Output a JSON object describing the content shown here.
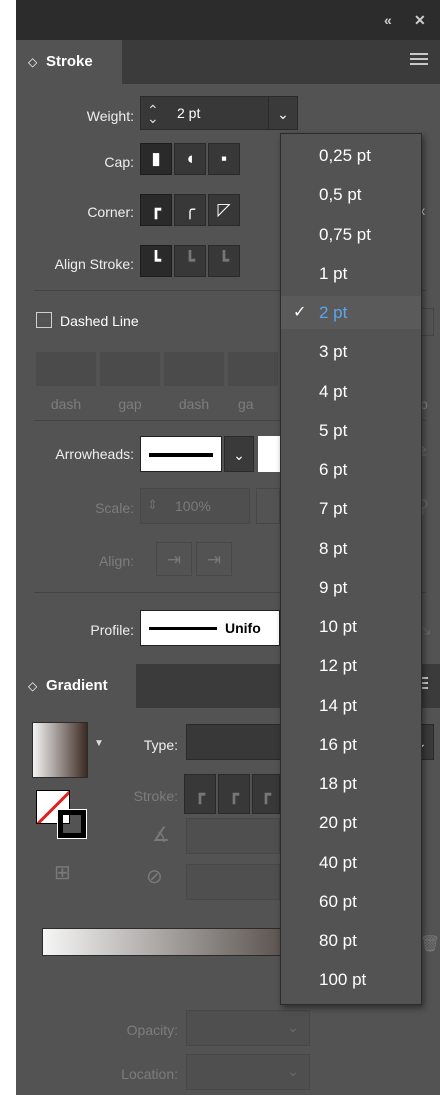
{
  "topbar": {
    "collapse_icon": "«",
    "close_icon": "✕"
  },
  "stroke_panel": {
    "tab_label": "Stroke",
    "tab_twisty": "◇",
    "weight_label": "Weight:",
    "weight_value": "2 pt",
    "cap_label": "Cap:",
    "corner_label": "Corner:",
    "align_label": "Align Stroke:",
    "dashed_label": "Dashed Line",
    "dash_gap_labels": [
      "dash",
      "gap",
      "dash",
      "ga"
    ],
    "dash_tail_label": "p",
    "arrowheads_label": "Arrowheads:",
    "scale_label": "Scale:",
    "scale_value": "100%",
    "align_arrow_label": "Align:",
    "profile_label": "Profile:",
    "profile_value": "Unifo"
  },
  "gradient_panel": {
    "tab_label": "Gradient",
    "type_label": "Type:",
    "stroke_label": "Stroke:",
    "opacity_label": "Opacity:",
    "location_label": "Location:"
  },
  "weight_dropdown": {
    "selected": "2 pt",
    "check_icon": "✓",
    "options": [
      "0,25 pt",
      "0,5 pt",
      "0,75 pt",
      "1 pt",
      "2 pt",
      "3 pt",
      "4 pt",
      "5 pt",
      "6 pt",
      "7 pt",
      "8 pt",
      "9 pt",
      "10 pt",
      "12 pt",
      "14 pt",
      "16 pt",
      "18 pt",
      "20 pt",
      "40 pt",
      "60 pt",
      "80 pt",
      "100 pt"
    ]
  },
  "colors": {
    "panel_bg": "#535353",
    "topbar_bg": "#2c2c2c",
    "selected_text": "#5aa4f2"
  }
}
